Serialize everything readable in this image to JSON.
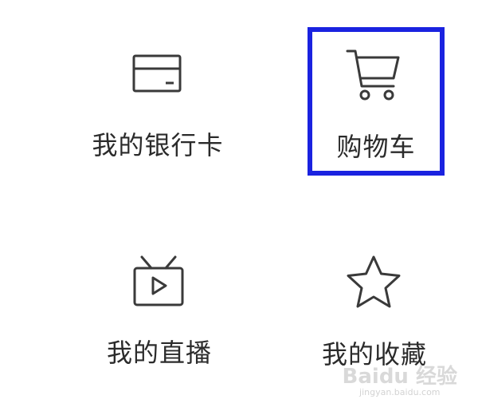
{
  "menu": {
    "items": [
      {
        "label": "我的银行卡",
        "icon": "bank-card-icon",
        "highlighted": false
      },
      {
        "label": "购物车",
        "icon": "shopping-cart-icon",
        "highlighted": true
      },
      {
        "label": "我的直播",
        "icon": "live-tv-icon",
        "highlighted": false
      },
      {
        "label": "我的收藏",
        "icon": "star-icon",
        "highlighted": false
      }
    ]
  },
  "highlight_color": "#1a22e0",
  "icon_color": "#3a3a3a",
  "watermark": {
    "logo": "Baidu 经验",
    "url": "jingyan.baidu.com"
  }
}
